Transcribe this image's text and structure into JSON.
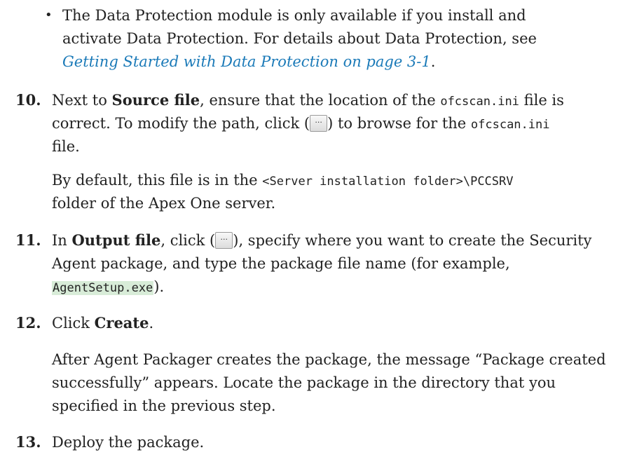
{
  "bullet": {
    "symbol": "•",
    "line1": "The Data Protection module is only available if you install and",
    "line2": "activate Data Protection. For details about Data Protection, see",
    "link": "Getting Started with Data Protection on page 3-1",
    "link_suffix": "."
  },
  "step10": {
    "number": "10.",
    "l1_a": "Next to ",
    "l1_bold": "Source file",
    "l1_b": ", ensure that the location of the ",
    "l1_code": "ofcscan.ini",
    "l1_c": " file is",
    "l2_a": "correct. To modify the path, click (",
    "l2_b": ") to browse for the ",
    "l2_code": "ofcscan.ini",
    "l3": "file.",
    "p2_l1_a": "By default, this file is in the ",
    "p2_l1_code": "<Server installation folder>\\PCCSRV",
    "p2_l2": "folder of the Apex One server."
  },
  "step11": {
    "number": "11.",
    "l1_a": "In ",
    "l1_bold": "Output file",
    "l1_b": ", click (",
    "l1_c": "), specify where you want to create the Security",
    "l2": "Agent package, and type the package file name (for example,",
    "l3_code": "AgentSetup.exe",
    "l3_b": ")."
  },
  "step12": {
    "number": "12.",
    "l1_a": "Click ",
    "l1_bold": "Create",
    "l1_b": ".",
    "p2_l1": "After Agent Packager creates the package, the message “Package created",
    "p2_l2": "successfully” appears. Locate the package in the directory that you",
    "p2_l3": "specified in the previous step."
  },
  "step13": {
    "number": "13.",
    "l1": "Deploy the package."
  },
  "browse_button": {
    "label": "..."
  }
}
